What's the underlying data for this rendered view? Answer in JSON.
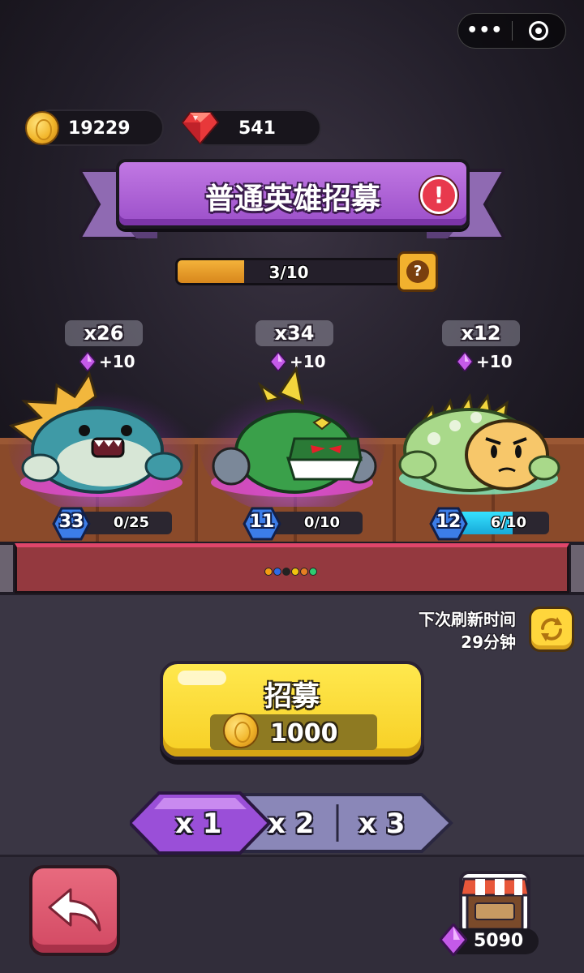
{
  "currency": {
    "coins": "19229",
    "rubies": "541"
  },
  "banner": {
    "title": "普通英雄招募",
    "alert_symbol": "!"
  },
  "progress": {
    "text": "3/10",
    "fraction": 0.3,
    "help_symbol": "?"
  },
  "heroes": [
    {
      "name_icon": "teal-dino-hero-icon",
      "count": "x26",
      "gem_bonus": "+10",
      "level": "33",
      "fragments": "0/25",
      "fragment_fraction": 0.0,
      "aura": "#c65cff"
    },
    {
      "name_icon": "green-robot-dragon-hero-icon",
      "count": "x34",
      "gem_bonus": "+10",
      "level": "11",
      "fragments": "0/10",
      "fragment_fraction": 0.0,
      "aura": "#c65cff"
    },
    {
      "name_icon": "spiky-green-turtle-hero-icon",
      "count": "x12",
      "gem_bonus": "+10",
      "level": "12",
      "fragments": "6/10",
      "fragment_fraction": 0.6,
      "aura": "#7ff0c2"
    }
  ],
  "carousel_dot_colors": [
    "#f39c12",
    "#2e6be6",
    "#222222",
    "#f1c40f",
    "#e67e22",
    "#2ecc71"
  ],
  "refresh": {
    "label": "下次刷新时间",
    "time": "29分钟"
  },
  "recruit": {
    "label": "招募",
    "cost": "1000"
  },
  "multipliers": [
    {
      "label": "x 1",
      "selected": true
    },
    {
      "label": "x 2",
      "selected": false
    },
    {
      "label": "x 3",
      "selected": false
    }
  ],
  "gem_total": "5090",
  "colors": {
    "accent_purple": "#a75bd3",
    "recruit_yellow": "#f7cf24",
    "back_red": "#d24963"
  }
}
